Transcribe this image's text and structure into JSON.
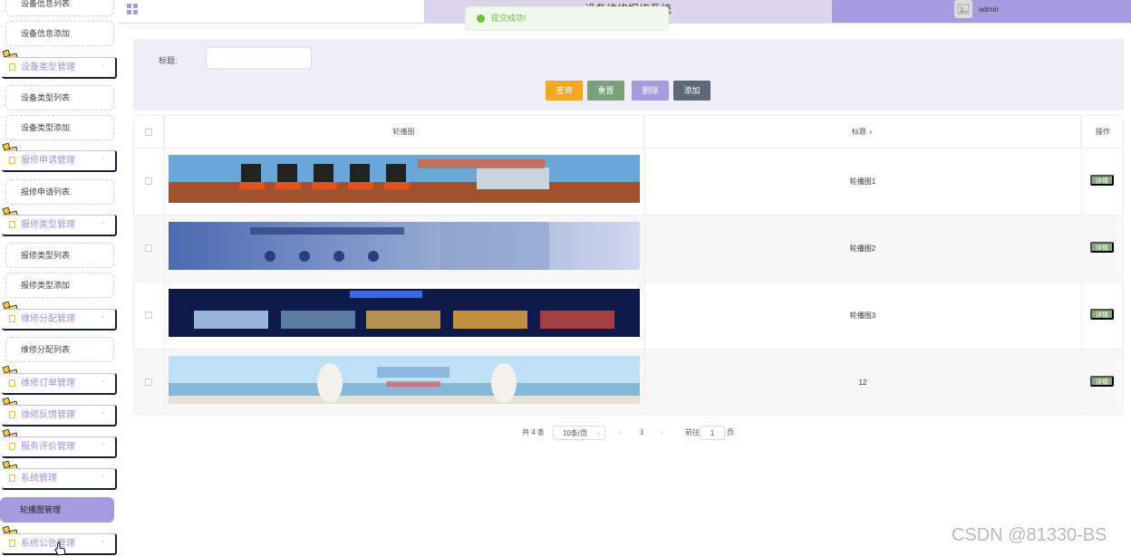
{
  "sidebar": {
    "items": [
      {
        "kind": "sub",
        "label": "设备信息列表"
      },
      {
        "kind": "sub",
        "label": "设备信息添加"
      },
      {
        "kind": "group",
        "label": "设备类型管理"
      },
      {
        "kind": "sub",
        "label": "设备类型列表"
      },
      {
        "kind": "sub",
        "label": "设备类型添加"
      },
      {
        "kind": "group",
        "label": "报修申请管理"
      },
      {
        "kind": "sub",
        "label": "报修申请列表"
      },
      {
        "kind": "group",
        "label": "报修类型管理"
      },
      {
        "kind": "sub",
        "label": "报修类型列表"
      },
      {
        "kind": "sub",
        "label": "报修类型添加"
      },
      {
        "kind": "group",
        "label": "维修分配管理"
      },
      {
        "kind": "sub",
        "label": "维修分配列表"
      },
      {
        "kind": "group",
        "label": "维修订单管理"
      },
      {
        "kind": "group",
        "label": "维修反馈管理"
      },
      {
        "kind": "group",
        "label": "服务评价管理"
      },
      {
        "kind": "group",
        "label": "系统管理"
      },
      {
        "kind": "active",
        "label": "轮播图管理"
      },
      {
        "kind": "group",
        "label": "系统公告管理"
      }
    ]
  },
  "header": {
    "title": "设备维修报修系统",
    "user": "admin"
  },
  "toast": {
    "message": "提交成功!"
  },
  "search": {
    "label": "标题:",
    "placeholder": "",
    "buttons": {
      "query": "查询",
      "reset": "重置",
      "delete": "删除",
      "add": "添加"
    },
    "button_colors": {
      "query": "#f5a623",
      "reset": "#7aa07a",
      "delete": "#a79be0",
      "add": "#5a6a7a"
    }
  },
  "table": {
    "headers": {
      "image": "轮播图",
      "title": "标题",
      "action": "操作"
    },
    "sort_icon": "sort-caret-icon",
    "detail_label": "详情",
    "rows": [
      {
        "title": "轮播图1"
      },
      {
        "title": "轮播图2"
      },
      {
        "title": "轮播图3"
      },
      {
        "title": "12"
      }
    ]
  },
  "pagination": {
    "total": "共 4 条",
    "page_size": "10条/页",
    "current": "1",
    "goto_label": "前往",
    "goto_value": "1",
    "page_suffix": "页"
  },
  "watermark": "CSDN @81330-BS"
}
